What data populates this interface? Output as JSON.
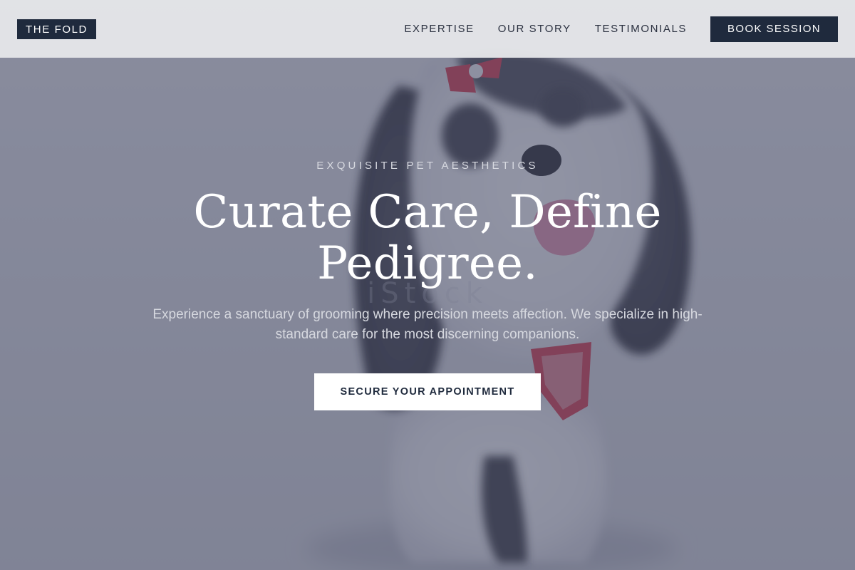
{
  "header": {
    "logo": "THE FOLD",
    "nav": [
      {
        "label": "EXPERTISE"
      },
      {
        "label": "OUR STORY"
      },
      {
        "label": "TESTIMONIALS"
      }
    ],
    "book_button": "BOOK SESSION"
  },
  "hero": {
    "eyebrow": "EXQUISITE PET AESTHETICS",
    "headline": "Curate Care, Define Pedigree.",
    "subtitle": "Experience a sanctuary of grooming where precision meets affection. We specialize in high-standard care for the most discerning companions.",
    "cta": "SECURE YOUR APPOINTMENT"
  },
  "colors": {
    "brand_navy": "#1f2a3d",
    "overlay": "#4e526c",
    "header_bg": "#e5e6e9",
    "white": "#ffffff"
  }
}
